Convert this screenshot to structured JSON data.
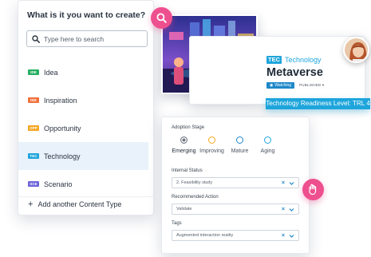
{
  "create_panel": {
    "title": "What is it you want to create?",
    "search_placeholder": "Type here to search",
    "types": [
      {
        "badge": "IDE",
        "label": "Idea",
        "color": "#27ae60"
      },
      {
        "badge": "INS",
        "label": "Inspiration",
        "color": "#f0713a"
      },
      {
        "badge": "OPP",
        "label": "Opportunity",
        "color": "#f5a623"
      },
      {
        "badge": "TEC",
        "label": "Technology",
        "color": "#1ea5dc"
      },
      {
        "badge": "SCE",
        "label": "Scenario",
        "color": "#6c63d9"
      }
    ],
    "selected": "Technology",
    "add_label": "Add another Content Type"
  },
  "content_card": {
    "type_badge": "TEC",
    "type_name": "Technology",
    "title": "Metaverse",
    "watching_label": "Watching",
    "status_label": "PUBLISHED",
    "trl_label": "Technology Readiness Level: TRL 4"
  },
  "form": {
    "adoption_stage_label": "Adoption Stage",
    "stages": [
      {
        "label": "Emerging",
        "color": "#6f7780"
      },
      {
        "label": "Improving",
        "color": "#f5a623"
      },
      {
        "label": "Mature",
        "color": "#1e88c9"
      },
      {
        "label": "Aging",
        "color": "#1ea5dc"
      }
    ],
    "selected_stage": "Emerging",
    "internal_status_label": "Internal Status",
    "internal_status_value": "2. Feasibility study",
    "recommended_action_label": "Recommended Action",
    "recommended_action_value": "Validate",
    "tags_label": "Tags",
    "tags_value": "Augmented interaction reality"
  },
  "colors": {
    "accent_pink": "#ee4f8e",
    "accent_blue": "#1ea5dc",
    "selected_row_bg": "#e9f2fb"
  },
  "icons": [
    "search-icon",
    "plus-icon",
    "eye-icon",
    "close-icon",
    "chevron-down-icon",
    "pointing-hand-icon"
  ]
}
